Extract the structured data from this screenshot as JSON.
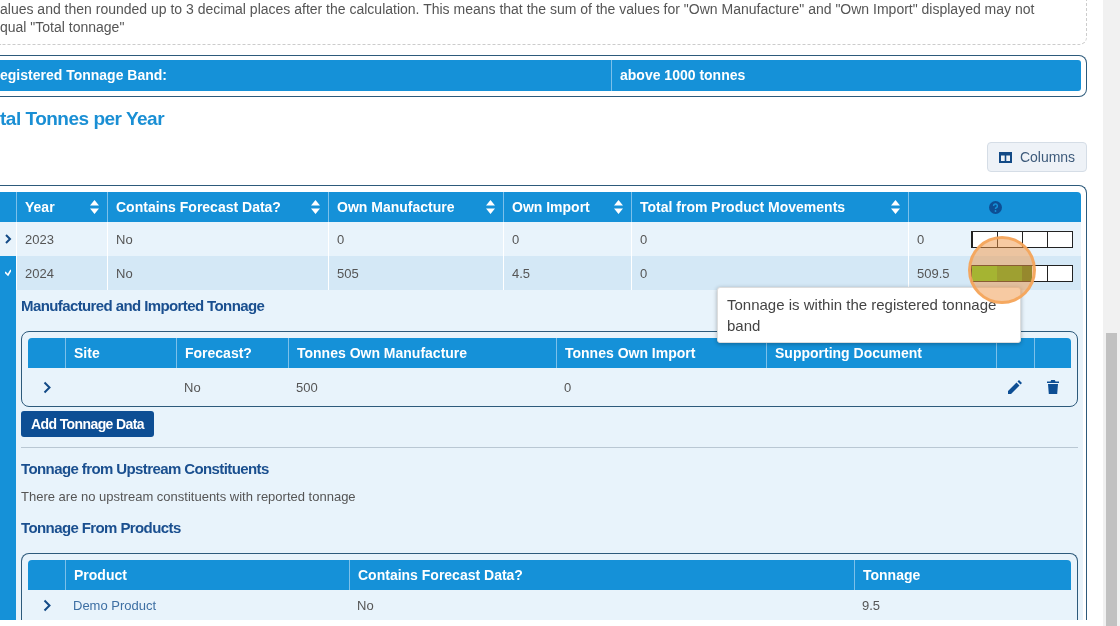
{
  "note": {
    "lines": [
      "alues and then rounded up to 3 decimal places after the calculation. This means that the sum of the values for \"Own Manufacture\" and \"Own Import\" displayed may not",
      "qual \"Total tonnage\""
    ]
  },
  "band": {
    "label": "egistered Tonnage Band:",
    "value": "above 1000 tonnes"
  },
  "section_title": "tal Tonnes per Year",
  "columns_button": "Columns",
  "table": {
    "columns": [
      {
        "label": "Year",
        "sortable": true
      },
      {
        "label": "Contains Forecast Data?",
        "sortable": true
      },
      {
        "label": "Own Manufacture",
        "sortable": true
      },
      {
        "label": "Own Import",
        "sortable": true
      },
      {
        "label": "Total from Product Movements",
        "sortable": true
      }
    ],
    "rows": [
      {
        "expanded": false,
        "year": "2023",
        "forecast": "No",
        "own_manufacture": "0",
        "own_import": "0",
        "total_movements": "0",
        "total": "0",
        "level": 0
      },
      {
        "expanded": true,
        "year": "2024",
        "forecast": "No",
        "own_manufacture": "505",
        "own_import": "4.5",
        "total_movements": "0",
        "total": "509.5",
        "level": 0.6
      }
    ]
  },
  "detail": {
    "title": "Manufactured and Imported Tonnage",
    "columns": [
      "Site",
      "Forecast?",
      "Tonnes Own Manufacture",
      "Tonnes Own Import",
      "Supporting Document"
    ],
    "rows": [
      {
        "forecast": "No",
        "own_manufacture": "500",
        "own_import": "0"
      }
    ],
    "add_button": "Add Tonnage Data",
    "upstream_title": "Tonnage from Upstream Constituents",
    "upstream_message": "There are no upstream constituents with reported tonnage",
    "products_title": "Tonnage From Products",
    "product_columns": [
      "Product",
      "Contains Forecast Data?",
      "Tonnage"
    ],
    "products": [
      {
        "product": "Demo Product",
        "forecast": "No",
        "tonnage": "9.5"
      }
    ]
  },
  "tooltip": "Tonnage is within the registered tonnage band"
}
